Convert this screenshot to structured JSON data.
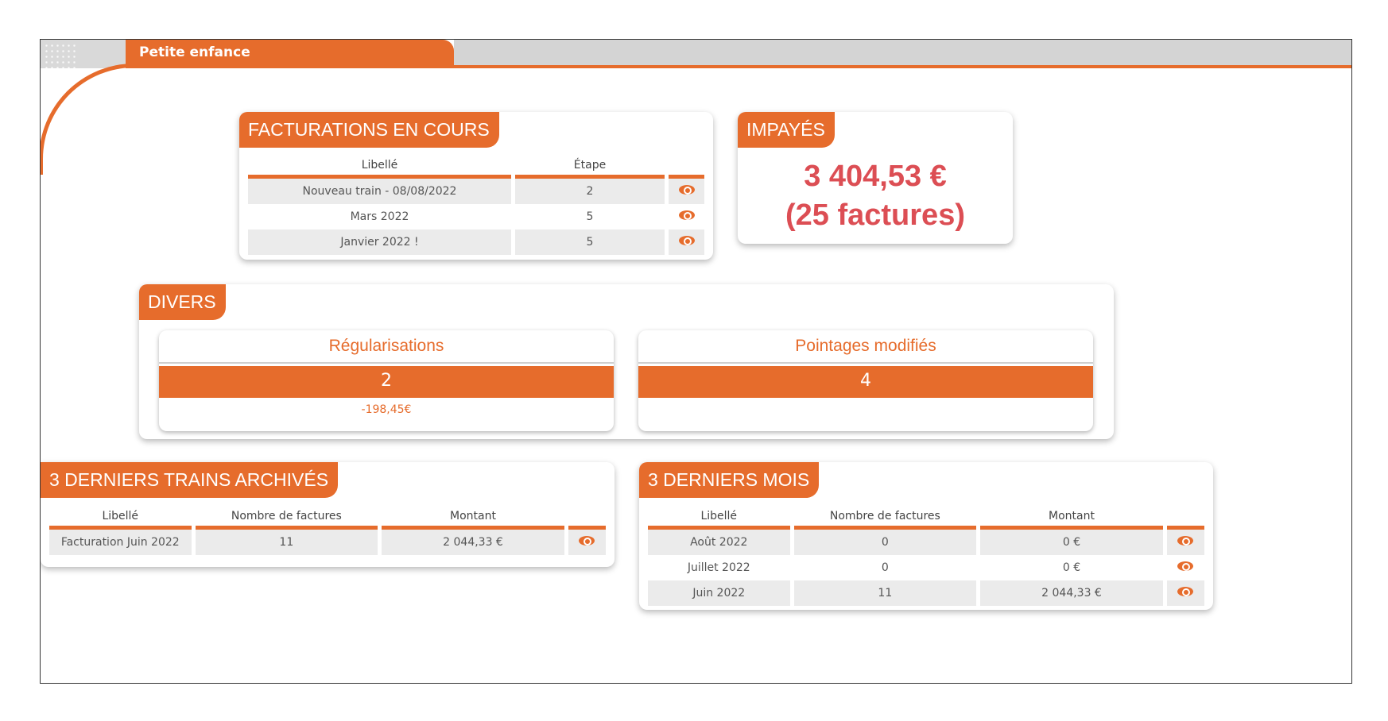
{
  "header": {
    "tab_label": "Petite enfance"
  },
  "facturations": {
    "title": "FACTURATIONS EN COURS",
    "columns": [
      "Libellé",
      "Étape",
      ""
    ],
    "rows": [
      {
        "libelle": "Nouveau train - 08/08/2022",
        "etape": "2"
      },
      {
        "libelle": "Mars 2022",
        "etape": "5"
      },
      {
        "libelle": "Janvier 2022 !",
        "etape": "5"
      }
    ]
  },
  "impayes": {
    "title": "IMPAYÉS",
    "amount": "3 404,53 €",
    "count": "(25 factures)"
  },
  "divers": {
    "title": "DIVERS",
    "regularisations": {
      "title": "Régularisations",
      "count": "2",
      "amount": "-198,45€"
    },
    "pointages": {
      "title": "Pointages modifiés",
      "count": "4"
    }
  },
  "trains_archives": {
    "title": "3 DERNIERS TRAINS ARCHIVÉS",
    "columns": [
      "Libellé",
      "Nombre de factures",
      "Montant",
      ""
    ],
    "rows": [
      {
        "libelle": "Facturation Juin 2022",
        "nombre": "11",
        "montant": "2 044,33 €"
      }
    ]
  },
  "derniers_mois": {
    "title": "3 DERNIERS MOIS",
    "columns": [
      "Libellé",
      "Nombre de factures",
      "Montant",
      ""
    ],
    "rows": [
      {
        "libelle": "Août 2022",
        "nombre": "0",
        "montant": "0 €"
      },
      {
        "libelle": "Juillet 2022",
        "nombre": "0",
        "montant": "0 €"
      },
      {
        "libelle": "Juin 2022",
        "nombre": "11",
        "montant": "2 044,33 €"
      }
    ]
  },
  "colors": {
    "accent": "#e66c2c",
    "amount_red": "#dc4e54",
    "row_alt": "#ebebeb"
  },
  "icons": {
    "view": "eye-icon"
  }
}
